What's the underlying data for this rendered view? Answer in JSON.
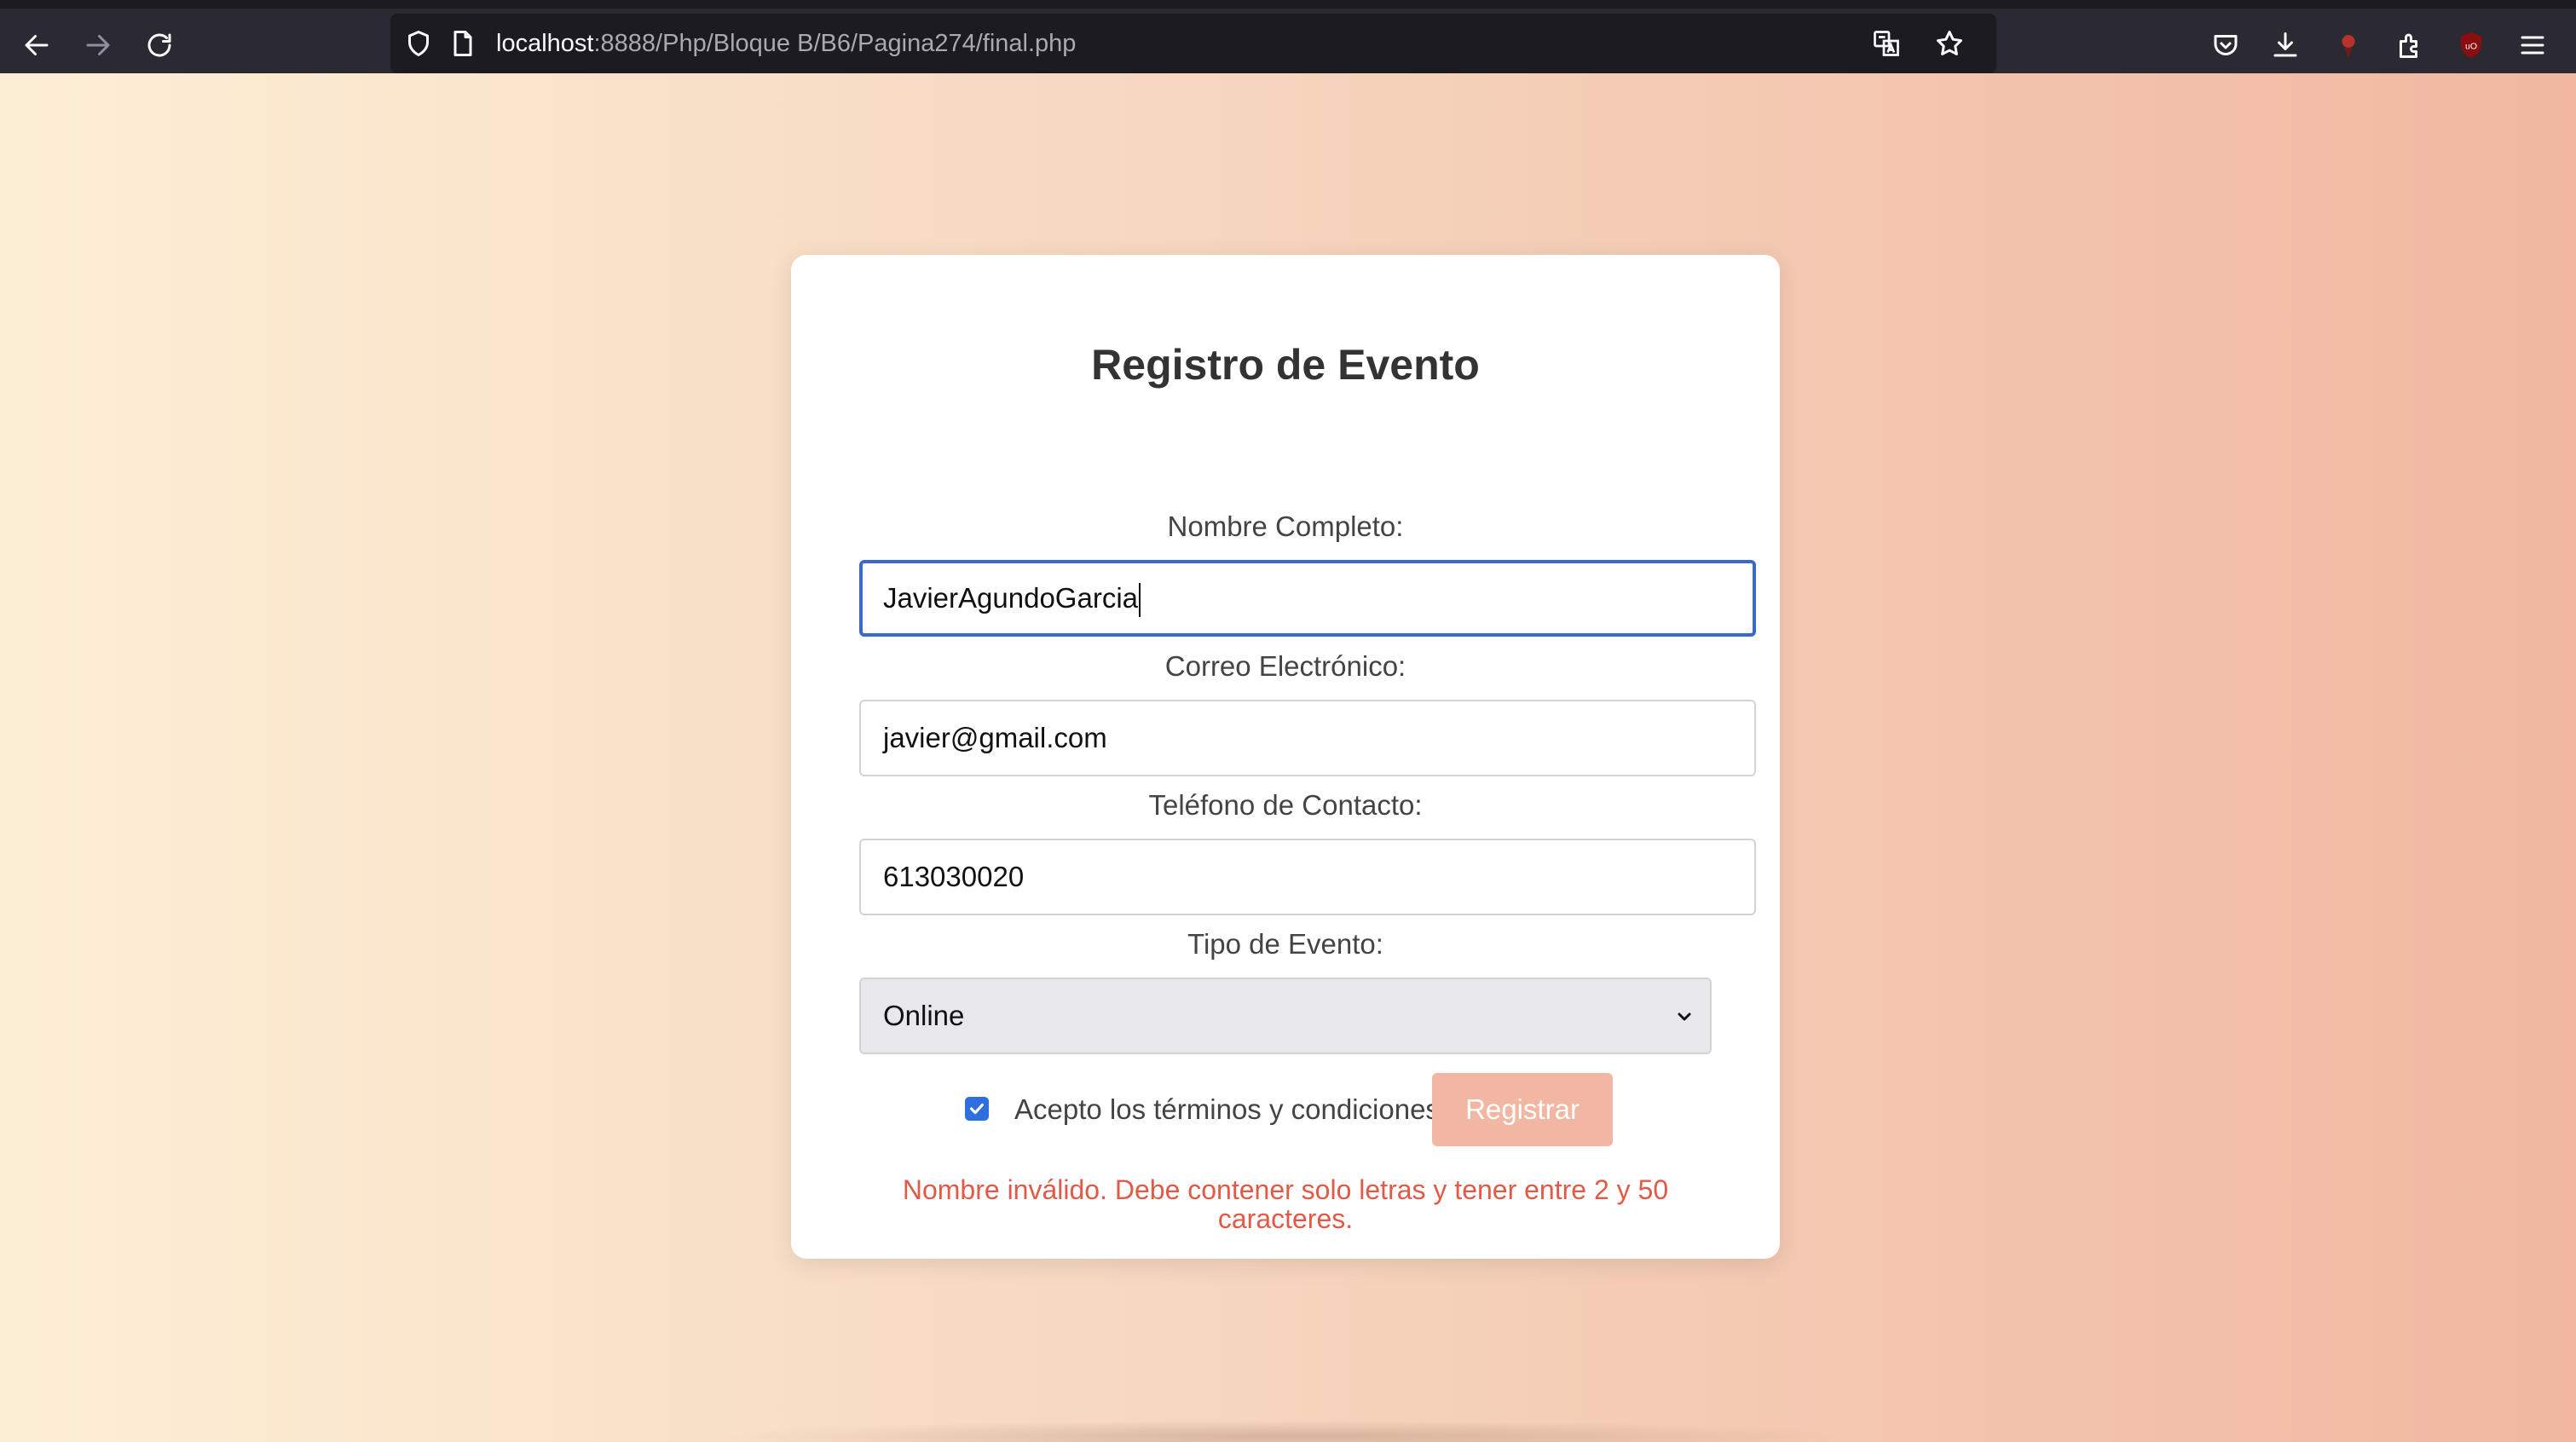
{
  "browser": {
    "url_host": "localhost",
    "url_path": ":8888/Php/Bloque B/B6/Pagina274/final.php",
    "icons": [
      "back-icon",
      "forward-icon",
      "reload-icon",
      "shield-icon",
      "page-icon",
      "translate-icon",
      "star-icon",
      "pocket-icon",
      "download-icon",
      "profile-icon",
      "extensions-icon",
      "ublock-icon",
      "menu-icon"
    ]
  },
  "form": {
    "title": "Registro de Evento",
    "name_label": "Nombre Completo:",
    "name_value": "JavierAgundoGarcia",
    "email_label": "Correo Electrónico:",
    "email_value": "javier@gmail.com",
    "phone_label": "Teléfono de Contacto:",
    "phone_value": "613030020",
    "event_label": "Tipo de Evento:",
    "event_value": "Online",
    "terms_label": "Acepto los términos y condiciones",
    "terms_checked": true,
    "submit_label": "Registrar",
    "error_message": "Nombre inválido. Debe contener solo letras y tener entre 2 y 50 caracteres."
  },
  "colors": {
    "accent": "#3a6ac8",
    "error": "#e25a46",
    "button": "#f2b7a3",
    "gradient_start": "#fdefd6",
    "gradient_end": "#f1b7a0"
  }
}
